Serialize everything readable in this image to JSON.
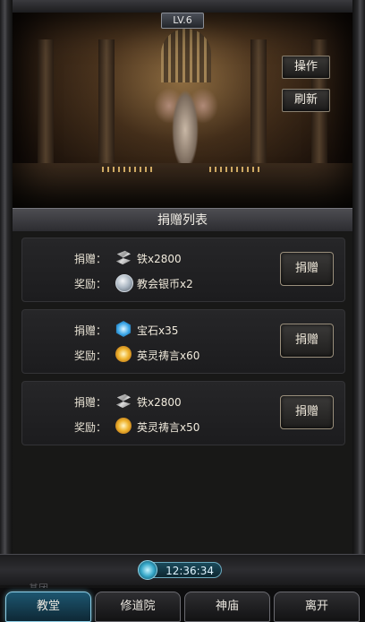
{
  "header": {
    "level": "LV.6"
  },
  "side_buttons": {
    "operate": "操作",
    "refresh": "刷新"
  },
  "panel": {
    "title": "捐赠列表",
    "donate_label": "捐赠：",
    "reward_label": "奖励：",
    "button_label": "捐赠",
    "rows": [
      {
        "donate_icon": "iron-icon",
        "donate_text": "铁x2800",
        "reward_icon": "silver-coin-icon",
        "reward_text": "教会银币x2"
      },
      {
        "donate_icon": "gem-icon",
        "donate_text": "宝石x35",
        "reward_icon": "prayer-icon",
        "reward_text": "英灵祷言x60"
      },
      {
        "donate_icon": "iron-icon",
        "donate_text": "铁x2800",
        "reward_icon": "prayer-icon",
        "reward_text": "英灵祷言x50"
      }
    ]
  },
  "status": {
    "time": "12:36:34",
    "ghost_label": "基团"
  },
  "tabs": [
    {
      "label": "教堂",
      "active": true
    },
    {
      "label": "修道院",
      "active": false
    },
    {
      "label": "神庙",
      "active": false
    },
    {
      "label": "离开",
      "active": false
    }
  ],
  "colors": {
    "tab_active": "#1d5670",
    "clock": "#1b4b5c"
  }
}
